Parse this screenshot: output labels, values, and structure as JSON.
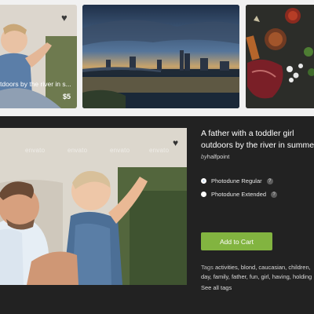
{
  "thumbnails": [
    {
      "caption": "tdoors by the river in s...",
      "price": "$5",
      "watermark": "envato"
    },
    {},
    {}
  ],
  "main": {
    "title": "A father with a toddler girl outdoors by the river in summer.",
    "author_prefix": "by",
    "author": "halfpoint",
    "watermark": "envato",
    "licenses": [
      {
        "label": "Photodune Regular",
        "selected": true
      },
      {
        "label": "Photodune Extended",
        "selected": false
      }
    ],
    "help_glyph": "?",
    "add_to_cart": "Add to Cart",
    "tags_label": "Tags",
    "tags": [
      "activities,",
      "blond,",
      "caucasian,",
      "children,",
      "day,",
      "family,",
      "father,",
      "fun,",
      "girl,",
      "having,",
      "holding"
    ],
    "see_all": "See all tags"
  },
  "colors": {
    "accent_green": "#82b440",
    "panel": "#222222",
    "top_strip": "#f1f1f1"
  },
  "icons": {
    "favorite": "heart-icon"
  }
}
